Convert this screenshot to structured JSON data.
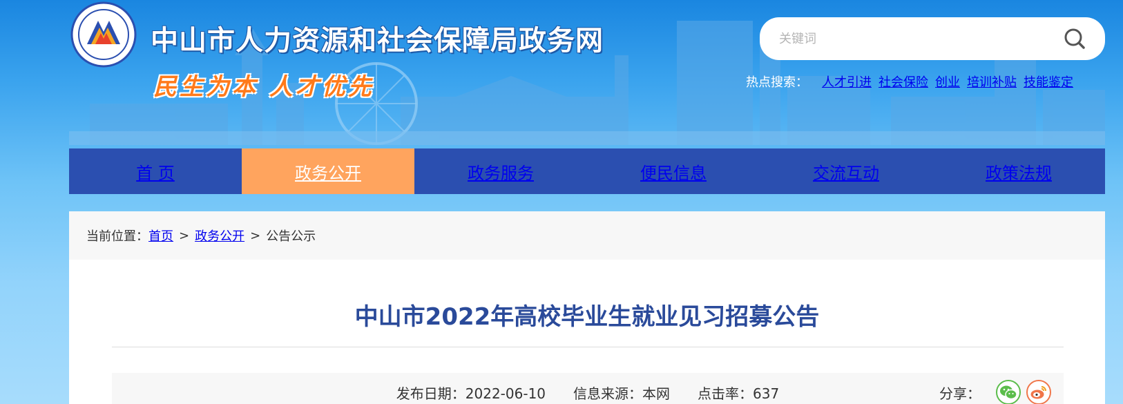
{
  "header": {
    "site_title": "中山市人力资源和社会保障局政务网",
    "slogan": "民生为本 人才优先",
    "logo_icon": "hrss-emblem-icon"
  },
  "search": {
    "placeholder": "关键词",
    "value": "",
    "icon": "search-icon"
  },
  "hot_search": {
    "label": "热点搜索：",
    "links": [
      "人才引进",
      "社会保险",
      "创业",
      "培训补贴",
      "技能鉴定"
    ]
  },
  "nav": {
    "items": [
      {
        "label": "首 页",
        "active": false
      },
      {
        "label": "政务公开",
        "active": true
      },
      {
        "label": "政务服务",
        "active": false
      },
      {
        "label": "便民信息",
        "active": false
      },
      {
        "label": "交流互动",
        "active": false
      },
      {
        "label": "政策法规",
        "active": false
      }
    ]
  },
  "breadcrumb": {
    "prefix": "当前位置：",
    "items": [
      "首页",
      "政务公开",
      "公告公示"
    ],
    "separator": ">"
  },
  "article": {
    "title": "中山市2022年高校毕业生就业见习招募公告",
    "publish_label": "发布日期：",
    "publish_date": "2022-06-10",
    "source_label": "信息来源：",
    "source": "本网",
    "hits_label": "点击率：",
    "hits": "637",
    "share_label": "分享：",
    "share_icons": [
      "wechat-icon",
      "weibo-icon"
    ]
  },
  "colors": {
    "nav_bg": "#2b4fb0",
    "nav_active": "#ffa45e",
    "title_color": "#2a4a9a",
    "slogan_color": "#ff7a1a"
  }
}
